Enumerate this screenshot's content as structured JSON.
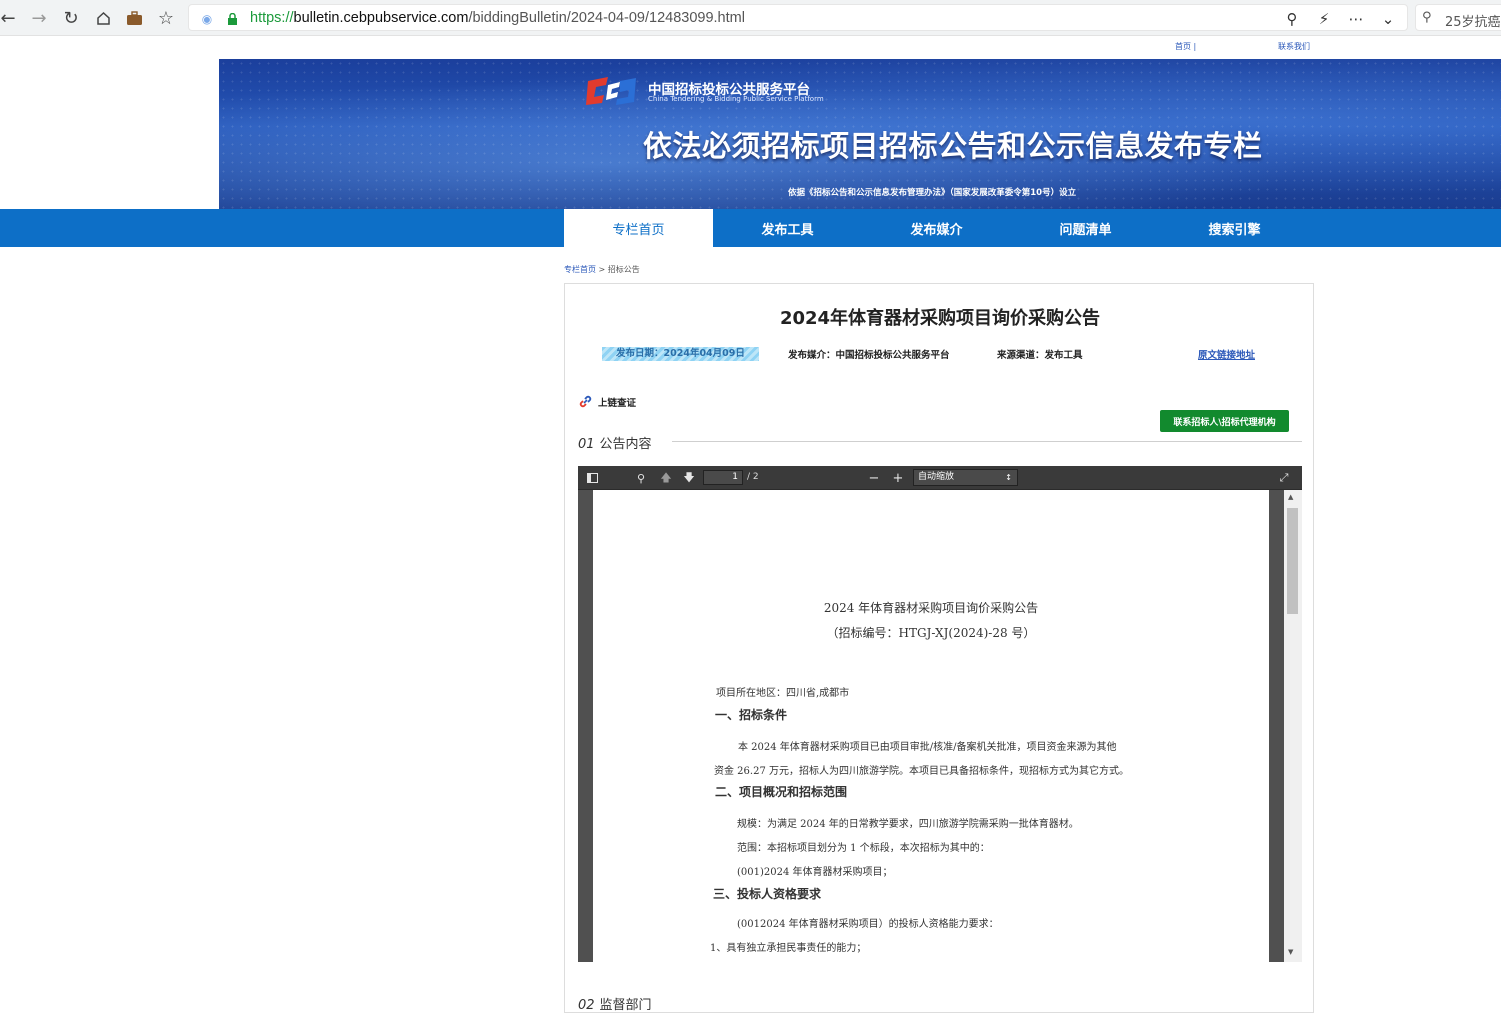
{
  "browser": {
    "url_protocol": "https://",
    "url_host": "bulletin.cebpubservice.com",
    "url_path": "/biddingBulletin/2024-04-09/12483099.html",
    "side_search_text": "25岁抗癌"
  },
  "top_links": {
    "home": "首页 |",
    "contact": "联系我们"
  },
  "banner": {
    "org_name": "中国招标投标公共服务平台",
    "org_name_en": "China Tendering & Bidding Public Service Platform",
    "title": "依法必须招标项目招标公告和公示信息发布专栏",
    "basis": "依据《招标公告和公示信息发布管理办法》（国家发展改革委令第10号）设立"
  },
  "nav": {
    "items": [
      {
        "label": "专栏首页"
      },
      {
        "label": "发布工具"
      },
      {
        "label": "发布媒介"
      },
      {
        "label": "问题清单"
      },
      {
        "label": "搜索引擎"
      }
    ]
  },
  "breadcrumb": {
    "home": "专栏首页",
    "sep": ">",
    "current": "招标公告"
  },
  "article": {
    "title": "2024年体育器材采购项目询价采购公告",
    "publish_date": "发布日期：2024年04月09日",
    "media": "发布媒介：中国招标投标公共服务平台",
    "source": "来源渠道：发布工具",
    "original_link": "原文链接地址",
    "chain_label": "上链查证",
    "contact_button": "联系招标人\\招标代理机构",
    "section1_num": "01",
    "section1_label": "公告内容",
    "section2_num": "02",
    "section2_label": "监督部门"
  },
  "pdf_viewer": {
    "page_current": "1",
    "page_total": "/ 2",
    "zoom": "自动缩放"
  },
  "document": {
    "title": "2024 年体育器材采购项目询价采购公告",
    "code": "（招标编号：HTGJ-XJ(2024)-28 号）",
    "region": "项目所在地区：四川省,成都市",
    "h1": "一、招标条件",
    "p1a": "本 2024 年体育器材采购项目已由项目审批/核准/备案机关批准，项目资金来源为其他",
    "p1b": "资金 26.27 万元，招标人为四川旅游学院。本项目已具备招标条件，现招标方式为其它方式。",
    "h2": "二、项目概况和招标范围",
    "p2a": "规模：为满足 2024 年的日常教学要求，四川旅游学院需采购一批体育器材。",
    "p2b": "范围：本招标项目划分为 1 个标段，本次招标为其中的：",
    "p2c": "(001)2024 年体育器材采购项目；",
    "h3": "三、投标人资格要求",
    "p3a": "(0012024 年体育器材采购项目）的投标人资格能力要求：",
    "p3b": "1、具有独立承担民事责任的能力；"
  },
  "colors": {
    "nav_blue": "#0d6fc7",
    "contact_green": "#128a2e",
    "link_blue": "#2b58b9"
  }
}
